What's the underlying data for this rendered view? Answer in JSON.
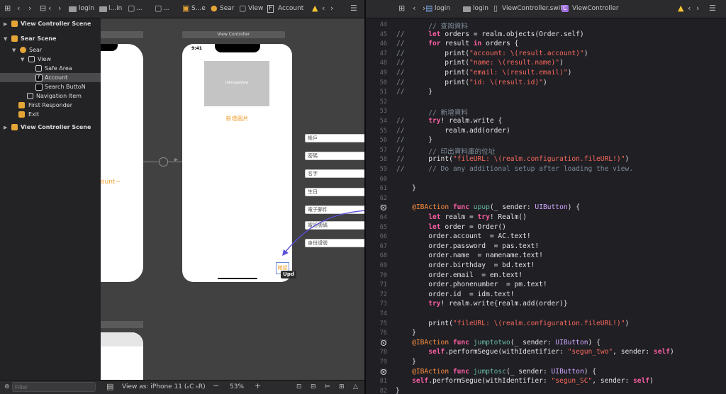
{
  "left_toolbar": {
    "crumbs": [
      "login",
      "l...in",
      "...",
      "...",
      "S...e",
      "Sear",
      "View",
      "Account"
    ]
  },
  "right_toolbar": {
    "crumbs": [
      "login",
      "login",
      "ViewController.swift",
      "ViewController"
    ]
  },
  "outline": {
    "items": [
      {
        "label": "View Controller Scene"
      },
      {
        "label": "Sear Scene"
      },
      {
        "label": "Sear"
      },
      {
        "label": "View"
      },
      {
        "label": "Safe Area"
      },
      {
        "label": "Account"
      },
      {
        "label": "Search ButtoN"
      },
      {
        "label": "Navigation Item"
      },
      {
        "label": "First Responder"
      },
      {
        "label": "Exit"
      },
      {
        "label": "View Controller Scene"
      }
    ],
    "filter_placeholder": "Filter"
  },
  "canvas": {
    "scene_title": "View Controller",
    "status_time": "9:41",
    "image_view_label": "UIImageView",
    "add_image_label": "新增圖片",
    "fields": [
      "帳戶",
      "密碼",
      "名字",
      "生日",
      "電子郵件",
      "電話號碼",
      "身份證號"
    ],
    "confirm_label": "確認",
    "tooltip": "Upd",
    "partial_label": "ount~",
    "view_as": "View as: iPhone 11 (ₒC ₕR)",
    "zoom": "53%"
  },
  "editor": {
    "lines": [
      {
        "n": "44",
        "g": "",
        "html": "        <span class='c'>// 查詢資料</span>"
      },
      {
        "n": "45",
        "g": "//",
        "html": "        <span class='k'>let</span> orders = realm.objects(Order.self)"
      },
      {
        "n": "46",
        "g": "//",
        "html": "        <span class='k'>for</span> result <span class='k'>in</span> orders {"
      },
      {
        "n": "47",
        "g": "//",
        "html": "            print(<span class='s'>\"account: \\(result.account)\"</span>)"
      },
      {
        "n": "48",
        "g": "//",
        "html": "            print(<span class='s'>\"name: \\(result.name)\"</span>)"
      },
      {
        "n": "49",
        "g": "//",
        "html": "            print(<span class='s'>\"email: \\(result.email)\"</span>)"
      },
      {
        "n": "50",
        "g": "//",
        "html": "            print(<span class='s'>\"id: \\(result.id)\"</span>)"
      },
      {
        "n": "51",
        "g": "//",
        "html": "        }"
      },
      {
        "n": "52",
        "g": "",
        "html": ""
      },
      {
        "n": "53",
        "g": "",
        "html": "        <span class='c'>// 新增資料</span>"
      },
      {
        "n": "54",
        "g": "//",
        "html": "        <span class='k'>try</span>! realm.write {"
      },
      {
        "n": "55",
        "g": "//",
        "html": "            realm.add(order)"
      },
      {
        "n": "56",
        "g": "//",
        "html": "        }"
      },
      {
        "n": "57",
        "g": "//",
        "html": "        <span class='c'>// 印出資料庫的位址</span>"
      },
      {
        "n": "58",
        "g": "//",
        "html": "        print(<span class='s'>\"fileURL: \\(realm.configuration.fileURL!)\"</span>)"
      },
      {
        "n": "59",
        "g": "//",
        "html": "        <span class='c'>// Do any additional setup after loading the view.</span>"
      },
      {
        "n": "60",
        "g": "",
        "html": ""
      },
      {
        "n": "61",
        "g": "",
        "html": "    }"
      },
      {
        "n": "62",
        "g": "",
        "html": ""
      },
      {
        "n": "63",
        "g": "",
        "html": "    <span class='attr'>@IBAction</span> <span class='k'>func</span> <span class='f'>upup</span>(_ sender: <span class='t'>UIButton</span>) {"
      },
      {
        "n": "64",
        "g": "",
        "html": "        <span class='k'>let</span> realm = <span class='k'>try</span>! Realm()"
      },
      {
        "n": "65",
        "g": "",
        "html": "        <span class='k'>let</span> order = Order()"
      },
      {
        "n": "66",
        "g": "",
        "html": "        order.account  = AC.text!"
      },
      {
        "n": "67",
        "g": "",
        "html": "        order.password  = pas.text!"
      },
      {
        "n": "68",
        "g": "",
        "html": "        order.name  = namename.text!"
      },
      {
        "n": "69",
        "g": "",
        "html": "        order.birthday  = bd.text!"
      },
      {
        "n": "70",
        "g": "",
        "html": "        order.email  = em.text!"
      },
      {
        "n": "71",
        "g": "",
        "html": "        order.phonenumber  = pm.text!"
      },
      {
        "n": "72",
        "g": "",
        "html": "        order.id  = idm.text!"
      },
      {
        "n": "73",
        "g": "",
        "html": "        <span class='k'>try</span>! realm.write{realm.add(order)}"
      },
      {
        "n": "74",
        "g": "",
        "html": ""
      },
      {
        "n": "75",
        "g": "",
        "html": "        print(<span class='s'>\"fileURL: \\(realm.configuration.fileURL!)\"</span>)"
      },
      {
        "n": "76",
        "g": "",
        "html": "    }"
      },
      {
        "n": "77",
        "g": "",
        "html": "    <span class='attr'>@IBAction</span> <span class='k'>func</span> <span class='f'>jumptotwo</span>(_ sender: <span class='t'>UIButton</span>) {"
      },
      {
        "n": "78",
        "g": "",
        "html": "        <span class='k'>self</span>.performSegue(withIdentifier: <span class='s'>\"segun_two\"</span>, sender: <span class='k'>self</span>)"
      },
      {
        "n": "79",
        "g": "",
        "html": "    }"
      },
      {
        "n": "80",
        "g": "",
        "html": "    <span class='attr'>@IBAction</span> <span class='k'>func</span> <span class='f'>jumptosc</span>(_ sender: <span class='t'>UIButton</span>) {"
      },
      {
        "n": "81",
        "g": "",
        "html": "    <span class='k'>self</span>.performSegue(withIdentifier: <span class='s'>\"segun_SC\"</span>, sender: <span class='k'>self</span>)"
      },
      {
        "n": "82",
        "g": "",
        "html": "}"
      }
    ]
  },
  "colors": {
    "accent_orange": "#f0a030",
    "keyword": "#fc5fa3",
    "string": "#fc6a5d",
    "comment": "#7f8c98",
    "type": "#d0a8ff",
    "connection_line": "#5a4fd6"
  }
}
